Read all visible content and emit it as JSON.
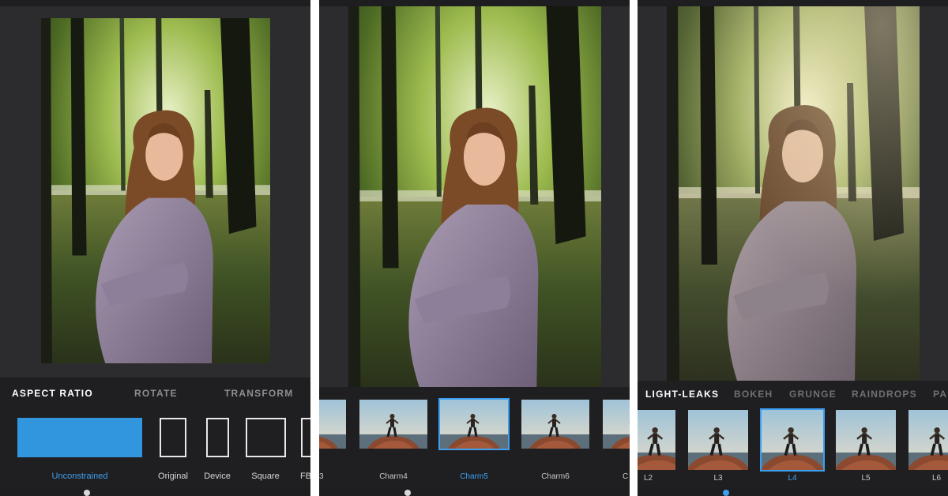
{
  "panel_edit": {
    "tabs": [
      "ASPECT RATIO",
      "ROTATE",
      "TRANSFORM"
    ],
    "options": [
      "Unconstrained",
      "Original",
      "Device",
      "Square",
      "FB"
    ]
  },
  "panel_filters": {
    "thumb_labels": [
      "3",
      "Charm4",
      "Charm5",
      "Charm6",
      "C"
    ],
    "selected": "Charm5"
  },
  "panel_overlays": {
    "categories": [
      "LIGHT-LEAKS",
      "BOKEH",
      "GRUNGE",
      "RAINDROPS",
      "PA"
    ],
    "thumb_labels": [
      "L2",
      "L3",
      "L4",
      "L5",
      "L6"
    ],
    "selected": "L4"
  },
  "colors": {
    "accent": "#3e9ff0",
    "panel_bg": "#2c2c2e",
    "toolbar_bg": "#1f1f21"
  }
}
